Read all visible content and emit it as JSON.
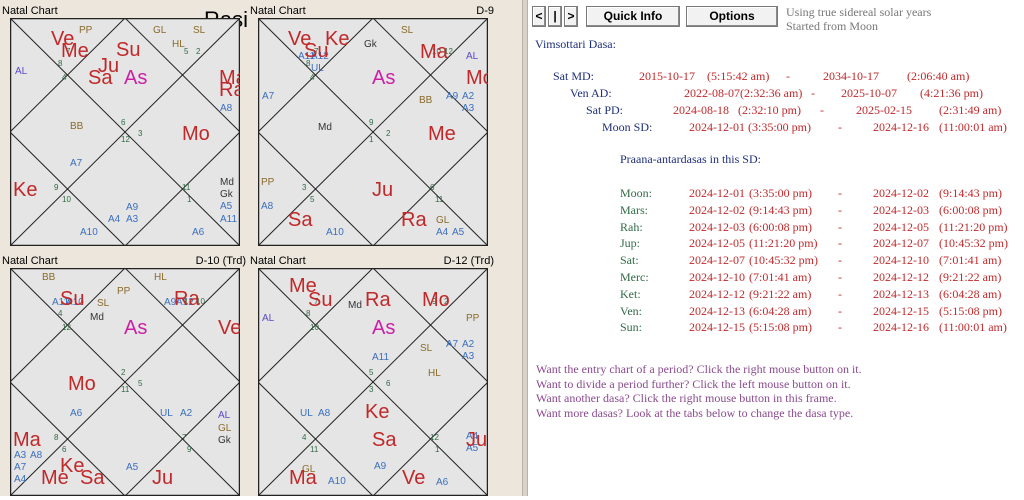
{
  "charts": {
    "rasi": {
      "title": "Natal Chart",
      "name": "Rasi",
      "planets": [
        {
          "t": "Ve",
          "c": "#c0282a"
        },
        {
          "t": "Me",
          "c": "#c0282a"
        },
        {
          "t": "Ju",
          "c": "#c0282a"
        },
        {
          "t": "Su",
          "c": "#c0282a"
        },
        {
          "t": "Sa",
          "c": "#c0282a"
        },
        {
          "t": "As",
          "c": "#cc1fa6"
        },
        {
          "t": "Ma",
          "c": "#c0282a"
        },
        {
          "t": "Ra",
          "c": "#c0282a"
        },
        {
          "t": "Mo",
          "c": "#c0282a"
        },
        {
          "t": "Ke",
          "c": "#c0282a"
        }
      ],
      "labels": [
        {
          "t": "PP",
          "c": "#8a6a2a"
        },
        {
          "t": "GL",
          "c": "#8a6a2a"
        },
        {
          "t": "SL",
          "c": "#8a6a2a"
        },
        {
          "t": "HL",
          "c": "#8a6a2a"
        },
        {
          "t": "AL",
          "c": "#5a4bc8"
        },
        {
          "t": "BB",
          "c": "#8a6a2a"
        },
        {
          "t": "A7",
          "c": "#3a6fbf"
        },
        {
          "t": "A8",
          "c": "#3a6fbf"
        },
        {
          "t": "A9",
          "c": "#3a6fbf"
        },
        {
          "t": "A4",
          "c": "#3a6fbf"
        },
        {
          "t": "A3",
          "c": "#3a6fbf"
        },
        {
          "t": "A10",
          "c": "#3a6fbf"
        },
        {
          "t": "A6",
          "c": "#3a6fbf"
        },
        {
          "t": "Md",
          "c": "#333"
        },
        {
          "t": "Gk",
          "c": "#333"
        },
        {
          "t": "A5",
          "c": "#3a6fbf"
        },
        {
          "t": "A11",
          "c": "#3a6fbf"
        }
      ],
      "nums": [
        "7",
        "8",
        "5",
        "4",
        "6",
        "12",
        "3",
        "9",
        "10",
        "11",
        "1",
        "2"
      ]
    },
    "d9": {
      "title": "Natal Chart",
      "name": "D-9",
      "planets": [
        {
          "t": "Ve",
          "c": "#c0282a"
        },
        {
          "t": "Ke",
          "c": "#c0282a"
        },
        {
          "t": "Su",
          "c": "#c0282a"
        },
        {
          "t": "Ma",
          "c": "#c0282a"
        },
        {
          "t": "As",
          "c": "#cc1fa6"
        },
        {
          "t": "Mo",
          "c": "#c0282a"
        },
        {
          "t": "Me",
          "c": "#c0282a"
        },
        {
          "t": "Ju",
          "c": "#c0282a"
        },
        {
          "t": "Sa",
          "c": "#c0282a"
        },
        {
          "t": "Ra",
          "c": "#c0282a"
        }
      ],
      "labels": [
        {
          "t": "A11",
          "c": "#3a6fbf"
        },
        {
          "t": "A12",
          "c": "#3a6fbf"
        },
        {
          "t": "UL",
          "c": "#3a6fbf"
        },
        {
          "t": "Gk",
          "c": "#333"
        },
        {
          "t": "SL",
          "c": "#8a6a2a"
        },
        {
          "t": "AL",
          "c": "#5a4bc8"
        },
        {
          "t": "A7",
          "c": "#3a6fbf"
        },
        {
          "t": "BB",
          "c": "#8a6a2a"
        },
        {
          "t": "A9",
          "c": "#3a6fbf"
        },
        {
          "t": "A2",
          "c": "#3a6fbf"
        },
        {
          "t": "A3",
          "c": "#3a6fbf"
        },
        {
          "t": "Md",
          "c": "#333"
        },
        {
          "t": "PP",
          "c": "#8a6a2a"
        },
        {
          "t": "A8",
          "c": "#3a6fbf"
        },
        {
          "t": "A10",
          "c": "#3a6fbf"
        },
        {
          "t": "GL",
          "c": "#8a6a2a"
        },
        {
          "t": "A4",
          "c": "#3a6fbf"
        },
        {
          "t": "A5",
          "c": "#3a6fbf"
        }
      ],
      "nums": [
        "7",
        "8",
        "10",
        "4",
        "9",
        "1",
        "2",
        "3",
        "5",
        "6",
        "11",
        "12"
      ]
    },
    "d10": {
      "title": "Natal Chart",
      "name": "D-10 (Trd)",
      "planets": [
        {
          "t": "Su",
          "c": "#c0282a"
        },
        {
          "t": "Ra",
          "c": "#c0282a"
        },
        {
          "t": "As",
          "c": "#cc1fa6"
        },
        {
          "t": "Ve",
          "c": "#c0282a"
        },
        {
          "t": "Mo",
          "c": "#c0282a"
        },
        {
          "t": "Ma",
          "c": "#c0282a"
        },
        {
          "t": "Ke",
          "c": "#c0282a"
        },
        {
          "t": "Me",
          "c": "#c0282a"
        },
        {
          "t": "Sa",
          "c": "#c0282a"
        },
        {
          "t": "Ju",
          "c": "#c0282a"
        }
      ],
      "labels": [
        {
          "t": "BB",
          "c": "#8a6a2a"
        },
        {
          "t": "HL",
          "c": "#8a6a2a"
        },
        {
          "t": "PP",
          "c": "#8a6a2a"
        },
        {
          "t": "A11",
          "c": "#3a6fbf"
        },
        {
          "t": "A10",
          "c": "#3a6fbf"
        },
        {
          "t": "SL",
          "c": "#8a6a2a"
        },
        {
          "t": "Md",
          "c": "#333"
        },
        {
          "t": "A9",
          "c": "#3a6fbf"
        },
        {
          "t": "A12",
          "c": "#3a6fbf"
        },
        {
          "t": "A6",
          "c": "#3a6fbf"
        },
        {
          "t": "UL",
          "c": "#3a6fbf"
        },
        {
          "t": "A2",
          "c": "#3a6fbf"
        },
        {
          "t": "AL",
          "c": "#5a4bc8"
        },
        {
          "t": "GL",
          "c": "#8a6a2a"
        },
        {
          "t": "Gk",
          "c": "#333"
        },
        {
          "t": "A3",
          "c": "#3a6fbf"
        },
        {
          "t": "A8",
          "c": "#3a6fbf"
        },
        {
          "t": "A7",
          "c": "#3a6fbf"
        },
        {
          "t": "A5",
          "c": "#3a6fbf"
        },
        {
          "t": "A4",
          "c": "#3a6fbf"
        }
      ],
      "nums": [
        "3",
        "4",
        "1",
        "12",
        "2",
        "11",
        "5",
        "8",
        "6",
        "7",
        "9",
        "10"
      ]
    },
    "d12": {
      "title": "Natal Chart",
      "name": "D-12 (Trd)",
      "planets": [
        {
          "t": "Me",
          "c": "#c0282a"
        },
        {
          "t": "Su",
          "c": "#c0282a"
        },
        {
          "t": "Ra",
          "c": "#c0282a"
        },
        {
          "t": "Mo",
          "c": "#c0282a"
        },
        {
          "t": "As",
          "c": "#cc1fa6"
        },
        {
          "t": "Ke",
          "c": "#c0282a"
        },
        {
          "t": "Sa",
          "c": "#c0282a"
        },
        {
          "t": "Ju",
          "c": "#c0282a"
        },
        {
          "t": "Ma",
          "c": "#c0282a"
        },
        {
          "t": "Ve",
          "c": "#c0282a"
        }
      ],
      "labels": [
        {
          "t": "Md",
          "c": "#333"
        },
        {
          "t": "AL",
          "c": "#5a4bc8"
        },
        {
          "t": "PP",
          "c": "#8a6a2a"
        },
        {
          "t": "A7",
          "c": "#3a6fbf"
        },
        {
          "t": "A2",
          "c": "#3a6fbf"
        },
        {
          "t": "A3",
          "c": "#3a6fbf"
        },
        {
          "t": "SL",
          "c": "#8a6a2a"
        },
        {
          "t": "A11",
          "c": "#3a6fbf"
        },
        {
          "t": "HL",
          "c": "#8a6a2a"
        },
        {
          "t": "UL",
          "c": "#3a6fbf"
        },
        {
          "t": "A8",
          "c": "#3a6fbf"
        },
        {
          "t": "A4",
          "c": "#3a6fbf"
        },
        {
          "t": "A5",
          "c": "#3a6fbf"
        },
        {
          "t": "GL",
          "c": "#8a6a2a"
        },
        {
          "t": "A10",
          "c": "#3a6fbf"
        },
        {
          "t": "A9",
          "c": "#3a6fbf"
        },
        {
          "t": "A6",
          "c": "#3a6fbf"
        }
      ],
      "nums": [
        "7",
        "8",
        "9",
        "10",
        "5",
        "3",
        "6",
        "4",
        "11",
        "12",
        "1",
        "2"
      ]
    }
  },
  "toolbar": {
    "nav_prev": "<",
    "nav_pause": "|",
    "nav_next": ">",
    "quick_info": "Quick Info",
    "options": "Options",
    "info_line1": "Using true sidereal solar years",
    "info_line2": "Started from Moon"
  },
  "dasa": {
    "header": "Vimsottari Dasa:",
    "rows": [
      {
        "label": "Sat MD:",
        "start": "2015-10-17",
        "start_time": "(5:15:42 am)",
        "sep": "-",
        "end": "2034-10-17",
        "end_time": "(2:06:40 am)"
      },
      {
        "label": "Ven AD:",
        "start": "2022-08-07",
        "start_time": "(2:32:36 am)",
        "sep": "-",
        "end": "2025-10-07",
        "end_time": "(4:21:36 pm)"
      },
      {
        "label": "Sat PD:",
        "start": "2024-08-18",
        "start_time": "(2:32:10 pm)",
        "sep": "-",
        "end": "2025-02-15",
        "end_time": "(2:31:49 am)"
      },
      {
        "label": "Moon SD:",
        "start": "2024-12-01",
        "start_time": "(3:35:00 pm)",
        "sep": "-",
        "end": "2024-12-16",
        "end_time": "(11:00:01 am)"
      }
    ],
    "praana_header": "Praana-antardasas in this SD:",
    "praana": [
      {
        "label": "Moon:",
        "start": "2024-12-01",
        "start_time": "(3:35:00 pm)",
        "sep": "-",
        "end": "2024-12-02",
        "end_time": "(9:14:43 pm)"
      },
      {
        "label": "Mars:",
        "start": "2024-12-02",
        "start_time": "(9:14:43 pm)",
        "sep": "-",
        "end": "2024-12-03",
        "end_time": "(6:00:08 pm)"
      },
      {
        "label": "Rah:",
        "start": "2024-12-03",
        "start_time": "(6:00:08 pm)",
        "sep": "-",
        "end": "2024-12-05",
        "end_time": "(11:21:20 pm)"
      },
      {
        "label": "Jup:",
        "start": "2024-12-05",
        "start_time": "(11:21:20 pm)",
        "sep": "-",
        "end": "2024-12-07",
        "end_time": "(10:45:32 pm)"
      },
      {
        "label": "Sat:",
        "start": "2024-12-07",
        "start_time": "(10:45:32 pm)",
        "sep": "-",
        "end": "2024-12-10",
        "end_time": "(7:01:41 am)"
      },
      {
        "label": "Merc:",
        "start": "2024-12-10",
        "start_time": "(7:01:41 am)",
        "sep": "-",
        "end": "2024-12-12",
        "end_time": "(9:21:22 am)"
      },
      {
        "label": "Ket:",
        "start": "2024-12-12",
        "start_time": "(9:21:22 am)",
        "sep": "-",
        "end": "2024-12-13",
        "end_time": "(6:04:28 am)"
      },
      {
        "label": "Ven:",
        "start": "2024-12-13",
        "start_time": "(6:04:28 am)",
        "sep": "-",
        "end": "2024-12-15",
        "end_time": "(5:15:08 pm)"
      },
      {
        "label": "Sun:",
        "start": "2024-12-15",
        "start_time": "(5:15:08 pm)",
        "sep": "-",
        "end": "2024-12-16",
        "end_time": "(11:00:01 am)"
      }
    ],
    "help": [
      "Want the entry chart of a period? Click the right mouse button on it.",
      "Want to divide a period further? Click the left mouse button on it.",
      "Want another dasa? Click the right mouse button in this frame.",
      "Want more dasas? Look at the tabs below to change the dasa type."
    ]
  }
}
